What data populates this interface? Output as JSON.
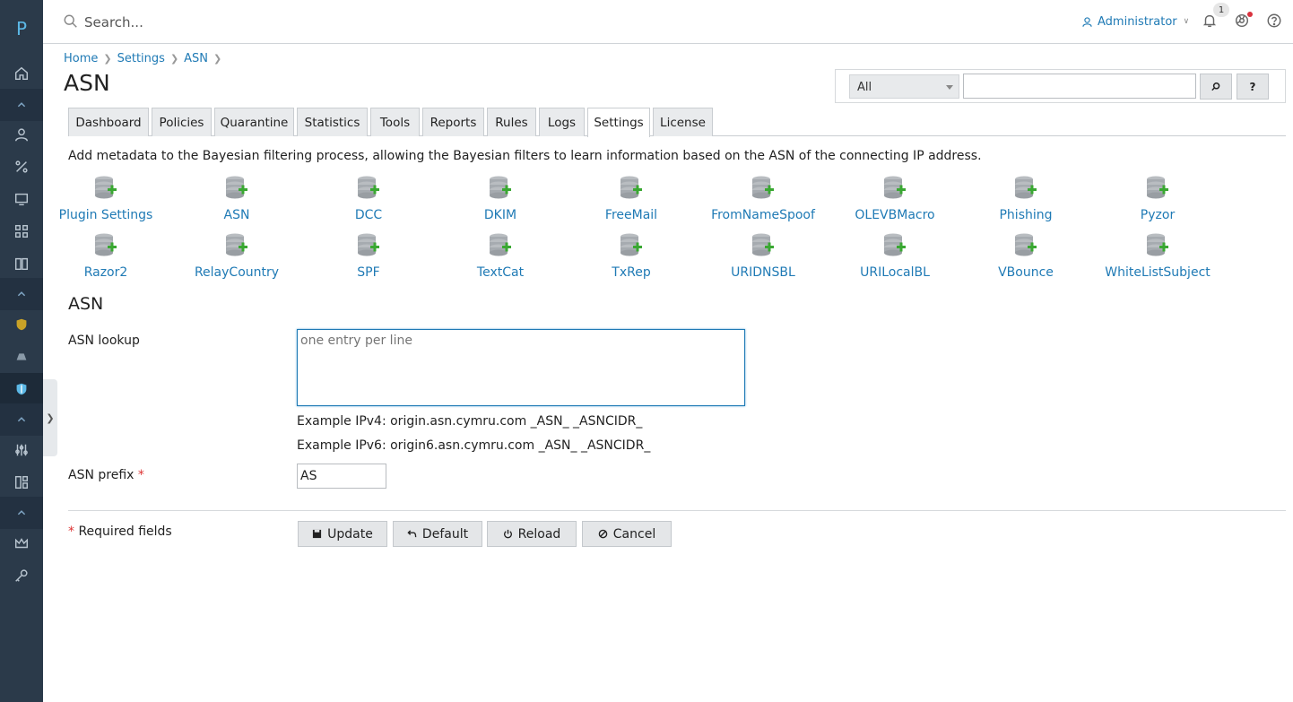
{
  "app": {
    "logo": "P"
  },
  "topbar": {
    "search_placeholder": "Search...",
    "user": "Administrator",
    "notifications_count": "1"
  },
  "breadcrumb": [
    "Home",
    "Settings",
    "ASN"
  ],
  "page_title": "ASN",
  "filter": {
    "select_value": "All",
    "search_button": "⌕",
    "help_button": "?"
  },
  "tabs": [
    "Dashboard",
    "Policies",
    "Quarantine",
    "Statistics",
    "Tools",
    "Reports",
    "Rules",
    "Logs",
    "Settings",
    "License"
  ],
  "active_tab": "Settings",
  "description": "Add metadata to the Bayesian filtering process, allowing the Bayesian filters to learn information based on the ASN of the connecting IP address.",
  "plugins": [
    "Plugin Settings",
    "ASN",
    "DCC",
    "DKIM",
    "FreeMail",
    "FromNameSpoof",
    "OLEVBMacro",
    "Phishing",
    "Pyzor",
    "Razor2",
    "RelayCountry",
    "SPF",
    "TextCat",
    "TxRep",
    "URIDNSBL",
    "URILocalBL",
    "VBounce",
    "WhiteListSubject"
  ],
  "form": {
    "section_title": "ASN",
    "asn_lookup_label": "ASN lookup",
    "asn_lookup_placeholder": "one entry per line",
    "example_ipv4": "Example IPv4: origin.asn.cymru.com _ASN_ _ASNCIDR_",
    "example_ipv6": "Example IPv6: origin6.asn.cymru.com _ASN_ _ASNCIDR_",
    "asn_prefix_label": "ASN prefix",
    "asn_prefix_value": "AS",
    "required_marker": "*",
    "required_fields": "Required fields"
  },
  "buttons": {
    "update": "Update",
    "default": "Default",
    "reload": "Reload",
    "cancel": "Cancel"
  },
  "colors": {
    "link": "#1f7ab5",
    "rail": "#2b3a4a",
    "required": "#dd3333"
  }
}
